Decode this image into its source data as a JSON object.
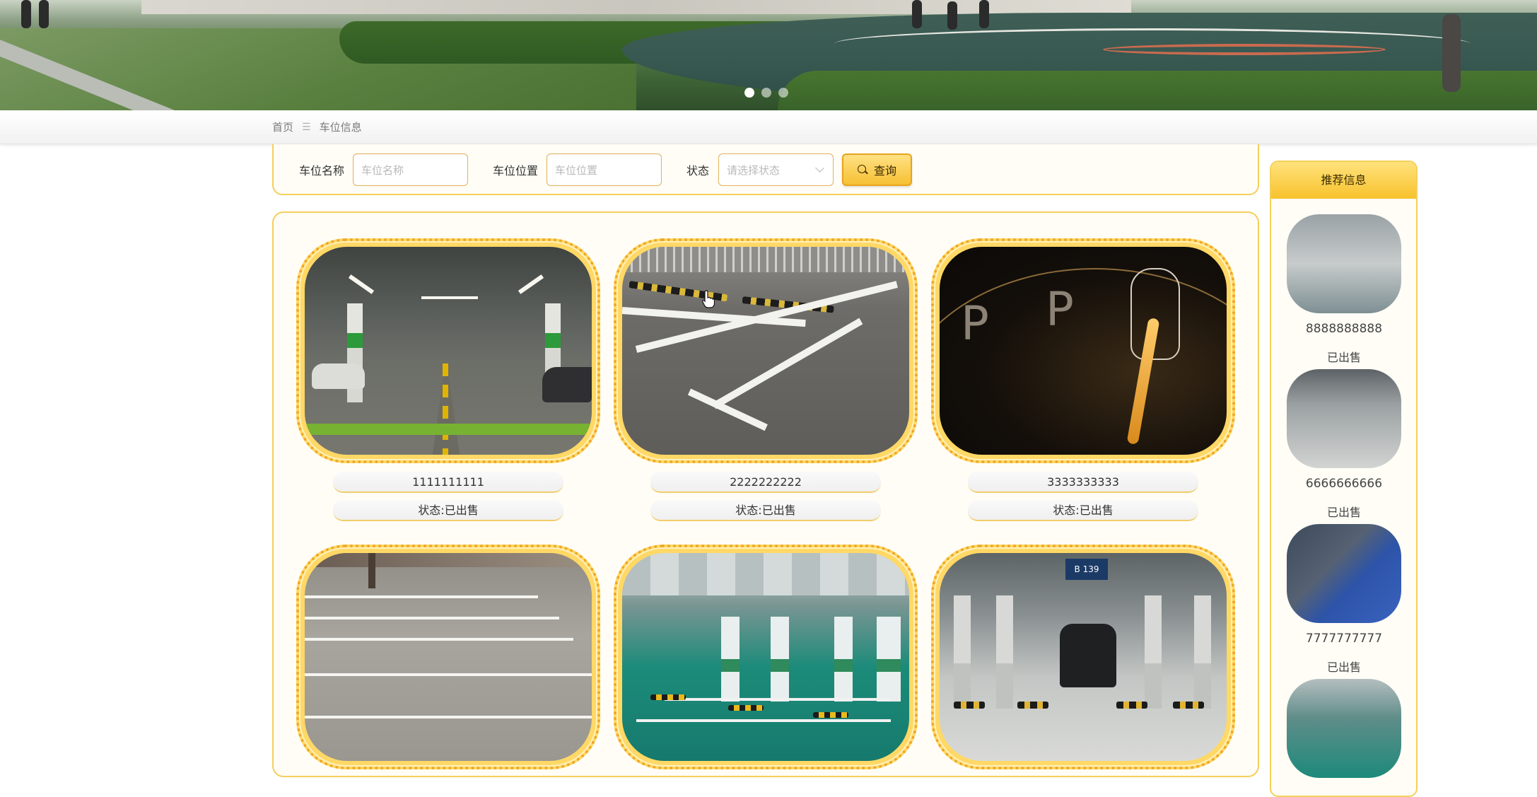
{
  "banner": {
    "carousel_dots": 3,
    "active_dot": 0
  },
  "breadcrumb": {
    "home": "首页",
    "separator": "☰",
    "current": "车位信息"
  },
  "filter": {
    "name_label": "车位名称",
    "name_placeholder": "车位名称",
    "location_label": "车位位置",
    "location_placeholder": "车位位置",
    "status_label": "状态",
    "status_placeholder": "请选择状态",
    "search_button": "查询"
  },
  "cards": [
    {
      "name": "1111111111",
      "status": "状态:已出售"
    },
    {
      "name": "2222222222",
      "status": "状态:已出售"
    },
    {
      "name": "3333333333",
      "status": "状态:已出售"
    },
    {
      "name": "",
      "status": ""
    },
    {
      "name": "",
      "status": ""
    },
    {
      "name": "",
      "status": ""
    }
  ],
  "sidebar": {
    "title": "推荐信息",
    "items": [
      {
        "name": "8888888888",
        "status": "已出售"
      },
      {
        "name": "6666666666",
        "status": "已出售"
      },
      {
        "name": "7777777777",
        "status": "已出售"
      },
      {
        "name": "",
        "status": ""
      }
    ]
  },
  "image_sign_text": "B 139",
  "colors": {
    "accent": "#f5cf5a",
    "button": "#f6c033",
    "panel_bg": "#fffdf6"
  }
}
